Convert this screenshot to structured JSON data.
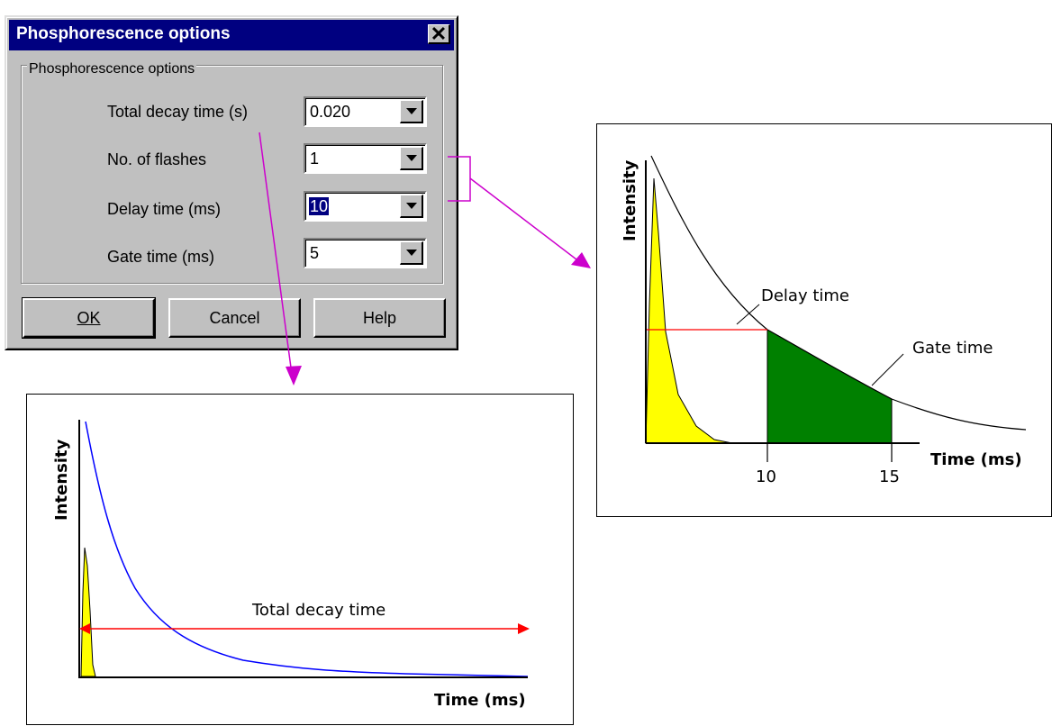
{
  "dialog": {
    "title": "Phosphorescence options",
    "close_label": "✕",
    "group_label": "Phosphorescence options",
    "fields": [
      {
        "label": "Total decay time (s)",
        "value": "0.020"
      },
      {
        "label": "No. of flashes",
        "value": "1"
      },
      {
        "label": "Delay time (ms)",
        "value": "10"
      },
      {
        "label": "Gate time (ms)",
        "value": "5"
      }
    ],
    "buttons": {
      "ok": "OK",
      "cancel": "Cancel",
      "help": "Help"
    }
  },
  "colors": {
    "titlebar": "#000080",
    "window_bg": "#c0c0c0",
    "callout_arrow": "#cc00cc",
    "flash_pulse": "#ffff00",
    "gate_fill": "#008000",
    "red_line": "#ff0000",
    "decay_curve_blue": "#0000ff"
  },
  "chart_data": [
    {
      "type": "area",
      "ylabel": "Intensity",
      "xlabel": "Time (ms)",
      "x_ticks": [
        "10",
        "15"
      ],
      "annotations": [
        "Delay time",
        "Gate time"
      ],
      "delay_ms": 10,
      "gate_ms": 5,
      "gate_window_ms": [
        10,
        15
      ]
    },
    {
      "type": "line",
      "ylabel": "Intensity",
      "xlabel": "Time (ms)",
      "annotations": [
        "Total decay time"
      ]
    }
  ]
}
